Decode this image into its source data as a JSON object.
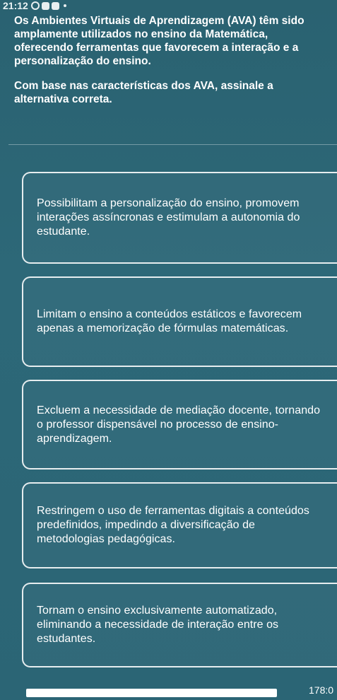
{
  "status_bar": {
    "time": "21:12"
  },
  "question": {
    "statement": "Os Ambientes Virtuais de Aprendizagem (AVA) têm sido amplamente utilizados no ensino da Matemática, oferecendo ferramentas que favorecem a interação e a personalização do ensino.",
    "prompt": "Com base nas características dos AVA, assinale a alternativa correta."
  },
  "options": [
    {
      "text": "Possibilitam a personalização do ensino, promovem interações assíncronas e estimulam a autonomia do estudante."
    },
    {
      "text": "Limitam o ensino a conteúdos estáticos e favorecem apenas a memorização de fórmulas matemáticas."
    },
    {
      "text": "Excluem a necessidade de mediação docente, tornando o professor dispensável no processo de ensino-aprendizagem."
    },
    {
      "text": "Restringem o uso de ferramentas digitais a conteúdos predefinidos, impedindo a diversificação de metodologias pedagógicas."
    },
    {
      "text": "Tornam o ensino exclusivamente automatizado, eliminando a necessidade de interação entre os estudantes."
    }
  ],
  "footer": {
    "timer": "178:0"
  },
  "colors": {
    "background": "#2b6575",
    "text": "#ffffff",
    "option_border": "#ffffff"
  }
}
